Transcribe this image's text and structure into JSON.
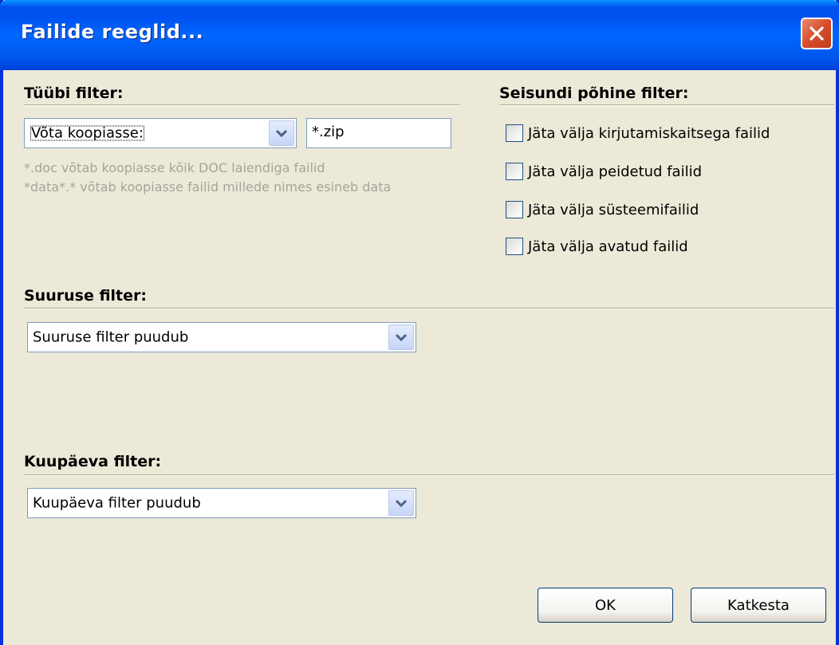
{
  "window": {
    "title": "Failide reeglid..."
  },
  "type_filter": {
    "title": "Tüübi filter:",
    "mode_selected": "Võta koopiasse:",
    "pattern_value": "*.zip",
    "hint_line1": "*.doc võtab koopiasse kõik DOC laiendiga failid",
    "hint_line2": "*data*.* võtab koopiasse failid millede nimes esineb data"
  },
  "state_filter": {
    "title": "Seisundi põhine filter:",
    "options": [
      {
        "label": "Jäta välja kirjutamiskaitsega failid",
        "checked": false
      },
      {
        "label": "Jäta välja peidetud failid",
        "checked": false
      },
      {
        "label": "Jäta välja süsteemifailid",
        "checked": false
      },
      {
        "label": "Jäta välja avatud failid",
        "checked": false
      }
    ]
  },
  "size_filter": {
    "title": "Suuruse filter:",
    "selected": "Suuruse filter puudub"
  },
  "date_filter": {
    "title": "Kuupäeva filter:",
    "selected": "Kuupäeva filter puudub"
  },
  "buttons": {
    "ok": "OK",
    "cancel": "Katkesta"
  },
  "colors": {
    "titlebar": "#0058ee",
    "dialog_bg": "#ece9d8",
    "close_button": "#d64d2a"
  }
}
